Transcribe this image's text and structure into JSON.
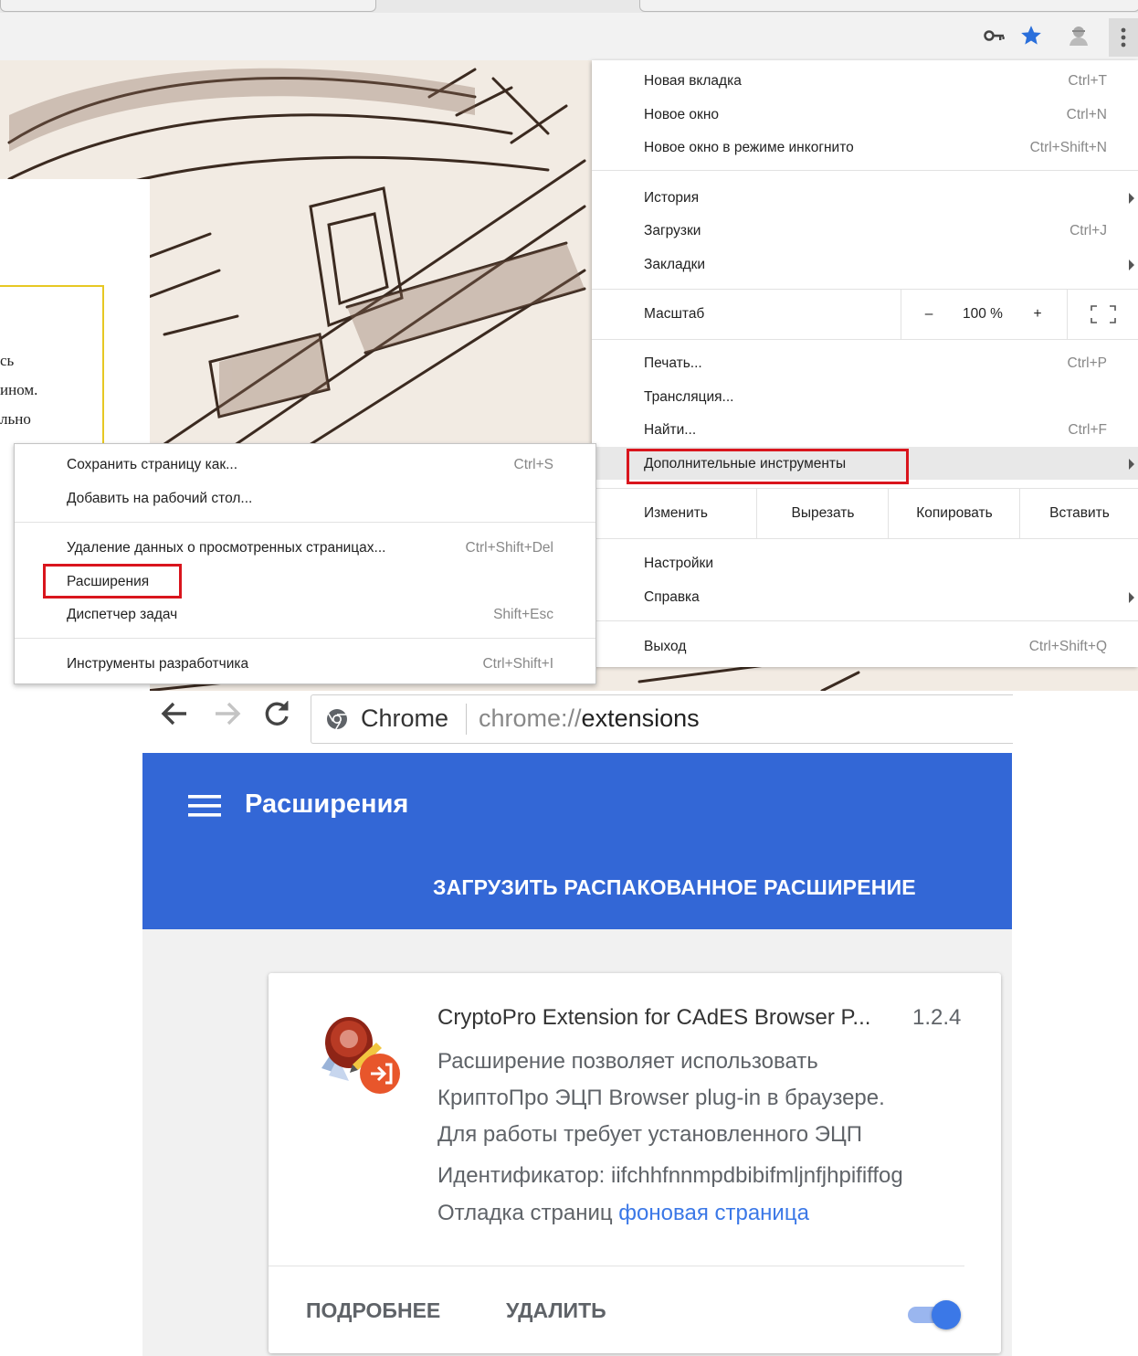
{
  "toolbar": {
    "icons": [
      "key-icon",
      "star-icon",
      "extension-user-icon",
      "menu-dots-icon"
    ],
    "star_color": "#2a6fdb"
  },
  "background_text": [
    "сь",
    "ином.",
    "льно"
  ],
  "main_menu": {
    "group1": [
      {
        "label": "Новая вкладка",
        "shortcut": "Ctrl+T"
      },
      {
        "label": "Новое окно",
        "shortcut": "Ctrl+N"
      },
      {
        "label": "Новое окно в режиме инкогнито",
        "shortcut": "Ctrl+Shift+N"
      }
    ],
    "group2": [
      {
        "label": "История",
        "shortcut": ""
      },
      {
        "label": "Загрузки",
        "shortcut": "Ctrl+J"
      },
      {
        "label": "Закладки",
        "shortcut": ""
      }
    ],
    "zoom": {
      "label": "Масштаб",
      "minus": "–",
      "value": "100 %",
      "plus": "+"
    },
    "group3": [
      {
        "label": "Печать...",
        "shortcut": "Ctrl+P"
      },
      {
        "label": "Трансляция...",
        "shortcut": ""
      },
      {
        "label": "Найти...",
        "shortcut": "Ctrl+F"
      },
      {
        "label": "Дополнительные инструменты",
        "shortcut": ""
      }
    ],
    "edit": {
      "label": "Изменить",
      "cut": "Вырезать",
      "copy": "Копировать",
      "paste": "Вставить"
    },
    "group4": [
      {
        "label": "Настройки",
        "shortcut": ""
      },
      {
        "label": "Справка",
        "shortcut": ""
      }
    ],
    "exit": {
      "label": "Выход",
      "shortcut": "Ctrl+Shift+Q"
    }
  },
  "sub_menu": {
    "group1": [
      {
        "label": "Сохранить страницу как...",
        "shortcut": "Ctrl+S"
      },
      {
        "label": "Добавить на рабочий стол...",
        "shortcut": ""
      }
    ],
    "group2": [
      {
        "label": "Удаление данных о просмотренных страницах...",
        "shortcut": "Ctrl+Shift+Del"
      },
      {
        "label": "Расширения",
        "shortcut": ""
      },
      {
        "label": "Диспетчер задач",
        "shortcut": "Shift+Esc"
      }
    ],
    "group3": [
      {
        "label": "Инструменты разработчика",
        "shortcut": "Ctrl+Shift+I"
      }
    ]
  },
  "highlight_color": "#d9151d",
  "extensions_page": {
    "omnibox": {
      "site_label": "Chrome",
      "url_prefix": "chrome://",
      "url_path": "extensions"
    },
    "header_title": "Расширения",
    "load_unpacked": "ЗАГРУЗИТЬ РАСПАКОВАННОЕ РАСШИРЕНИЕ",
    "header_color": "#3367d6",
    "card": {
      "name": "CryptoPro Extension for CAdES Browser P...",
      "version": "1.2.4",
      "description": [
        "Расширение позволяет использовать",
        "КриптоПро ЭЦП Browser plug-in в браузере.",
        "Для работы требует установленного ЭЦП"
      ],
      "id_label": "Идентификатор: iifchhfnnmpdbibifmljnfjhpififfog",
      "inspect_label": "Отладка страниц",
      "inspect_link": "фоновая страница",
      "details": "ПОДРОБНЕЕ",
      "remove": "УДАЛИТЬ",
      "enabled": true,
      "link_color": "#3b78e7"
    }
  }
}
